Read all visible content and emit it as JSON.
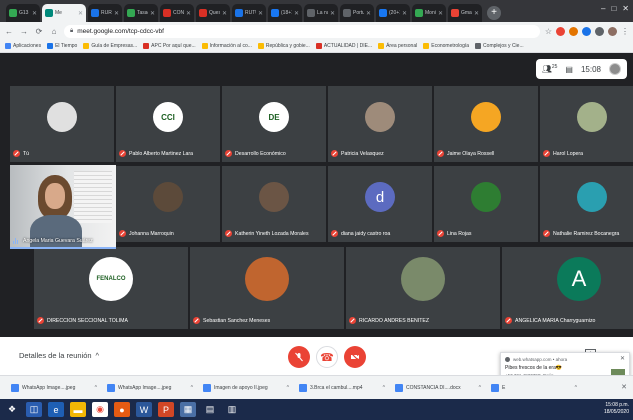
{
  "tabs": [
    {
      "label": "G13 D",
      "favicon_color": "#34a853"
    },
    {
      "label": "Me",
      "favicon_color": "#00897b",
      "active": true
    },
    {
      "label": "RURE",
      "favicon_color": "#1a73e8"
    },
    {
      "label": "Tasaci",
      "favicon_color": "#34a853"
    },
    {
      "label": "CONV",
      "favicon_color": "#d93025"
    },
    {
      "label": "Questa",
      "favicon_color": "#d93025"
    },
    {
      "label": "RUTU",
      "favicon_color": "#1a73e8"
    },
    {
      "label": "(18+1",
      "favicon_color": "#1877f2"
    },
    {
      "label": "La nue",
      "favicon_color": "#5f6368"
    },
    {
      "label": "Portu",
      "favicon_color": "#5f6368"
    },
    {
      "label": "(20+1",
      "favicon_color": "#1877f2"
    },
    {
      "label": "Monit",
      "favicon_color": "#34a853"
    },
    {
      "label": "Gmail",
      "favicon_color": "#ea4335"
    }
  ],
  "omnibox": {
    "url": "meet.google.com/tcp-cdcc-vbf"
  },
  "bookmarks": [
    {
      "label": "Aplicaciones",
      "color": "#4285f4"
    },
    {
      "label": "El Tiempo",
      "color": "#1a73e8"
    },
    {
      "label": "Guía de Empresas...",
      "color": "#fbbc04"
    },
    {
      "label": "APC Por aquí que...",
      "color": "#d93025"
    },
    {
      "label": "Información al co...",
      "color": "#fbbc04"
    },
    {
      "label": "República y gobie...",
      "color": "#fbbc04"
    },
    {
      "label": "ACTUALIDAD | DIE...",
      "color": "#d93025"
    },
    {
      "label": "Área personal",
      "color": "#fbbc04"
    },
    {
      "label": "Econometrología",
      "color": "#fbbc04"
    },
    {
      "label": "Complejos y Cie...",
      "color": "#5f6368"
    }
  ],
  "topbar": {
    "people_count": "25",
    "time": "15:08"
  },
  "participants": [
    {
      "name": "Tú",
      "avatar": "",
      "bg": "#e0e0e0"
    },
    {
      "name": "Pablo Alberto Martinez Lara",
      "avatar": "CCI",
      "bg": "#ffffff"
    },
    {
      "name": "Desarrollo Económico",
      "avatar": "DE",
      "bg": "#ffffff"
    },
    {
      "name": "Patricia Velasquez",
      "avatar": "",
      "bg": "#9e8b7a"
    },
    {
      "name": "Jaime Olaya Rossell",
      "avatar": "",
      "bg": "#f5a623"
    },
    {
      "name": "Harol Lopera",
      "avatar": "",
      "bg": "#a3b18a"
    },
    {
      "name": "Johanna Marroquin",
      "avatar": "",
      "bg": "#5c4a3a"
    },
    {
      "name": "Katherin Yineth Lozada Morales",
      "avatar": "",
      "bg": "#6b5545"
    },
    {
      "name": "diana jaidy castro roa",
      "avatar": "d",
      "bg": "#5c6bc0"
    },
    {
      "name": "Lina Rojas",
      "avatar": "",
      "bg": "#2e7d32"
    },
    {
      "name": "Nathalie Ramirez Bocanegra",
      "avatar": "",
      "bg": "#2a9fb0"
    },
    {
      "name": "DIRECCION SECCIONAL TOLIMA",
      "avatar": "FENALCO",
      "bg": "#ffffff"
    },
    {
      "name": "Sebastian Sanchez Meneses",
      "avatar": "",
      "bg": "#c0652f"
    },
    {
      "name": "RICARDO ANDRES BENITEZ",
      "avatar": "",
      "bg": "#7a8a6a"
    },
    {
      "name": "ANGELICA MARIA Charryguarnizo",
      "avatar": "A",
      "bg": "#0b7a5a"
    }
  ],
  "self_tile": {
    "name": "Angela Maria Guevara Suárez"
  },
  "bottombar": {
    "details_label": "Detalles de la reunión"
  },
  "notification": {
    "source": "web.whatsapp.com • ahora",
    "title": "Pibes frescos de la era😎",
    "body": "+57 301 4837708: Ogún"
  },
  "downloads": [
    {
      "name": "WhatsApp Image....jpeg"
    },
    {
      "name": "WhatsApp Image....jpeg"
    },
    {
      "name": "Imagen de apoyo II.jpeg"
    },
    {
      "name": "3.Brca el cambul....mp4"
    },
    {
      "name": "CONSTANCIA DI....docx"
    },
    {
      "name": "E"
    }
  ],
  "tray": {
    "time": "15:08 p.m.",
    "date": "18/05/2020"
  }
}
